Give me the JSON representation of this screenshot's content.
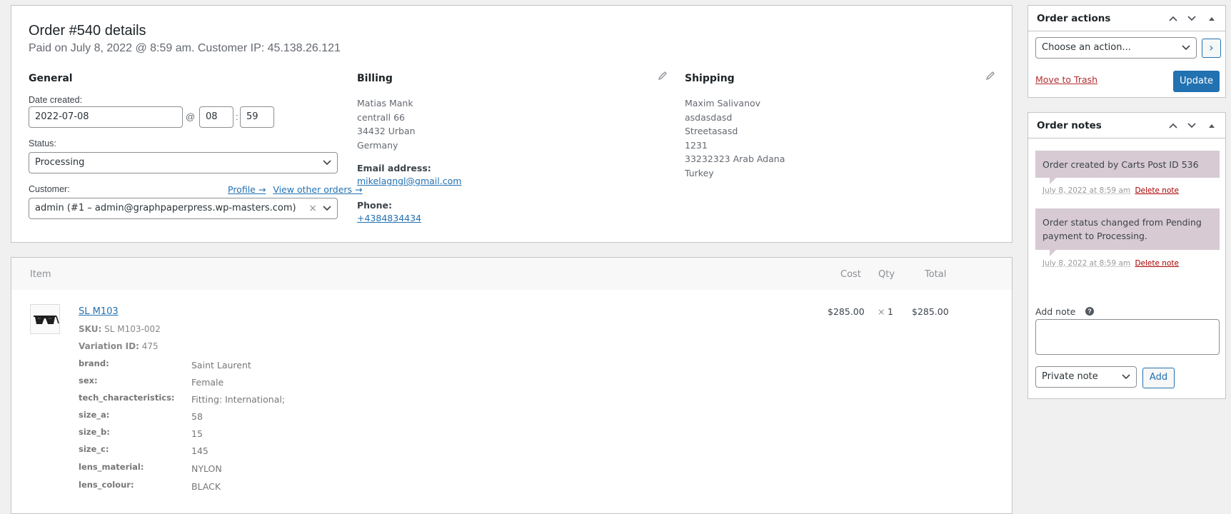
{
  "order": {
    "title": "Order #540 details",
    "subtitle": "Paid on July 8, 2022 @ 8:59 am. Customer IP: 45.138.26.121"
  },
  "general": {
    "heading": "General",
    "date_label": "Date created:",
    "date_value": "2022-07-08",
    "at": "@",
    "hour": "08",
    "colon": ":",
    "minute": "59",
    "status_label": "Status:",
    "status_value": "Processing",
    "customer_label": "Customer:",
    "profile_link": "Profile →",
    "other_orders_link": "View other orders →",
    "customer_value": "admin (#1 – admin@graphpaperpress.wp-masters.com)",
    "clear": "×"
  },
  "billing": {
    "heading": "Billing",
    "lines": [
      "Matias Mank",
      "centrall 66",
      "34432 Urban",
      "Germany"
    ],
    "email_label": "Email address:",
    "email": "mikelagngl@gmail.com",
    "phone_label": "Phone:",
    "phone": "+4384834434"
  },
  "shipping": {
    "heading": "Shipping",
    "lines": [
      "Maxim Salivanov",
      "asdasdasd",
      "Streetasasd",
      "1231",
      "33232323 Arab Adana",
      "Turkey"
    ]
  },
  "items": {
    "headers": {
      "item": "Item",
      "cost": "Cost",
      "qty": "Qty",
      "total": "Total"
    },
    "row": {
      "name": "SL M103",
      "sku_label": "SKU:",
      "sku": "SL M103-002",
      "variation_label": "Variation ID:",
      "variation": "475",
      "cost": "$285.00",
      "times": "×",
      "qty": "1",
      "total": "$285.00",
      "meta": [
        {
          "key": "brand:",
          "value": "Saint Laurent"
        },
        {
          "key": "sex:",
          "value": "Female"
        },
        {
          "key": "tech_characteristics:",
          "value": "Fitting: International;"
        },
        {
          "key": "size_a:",
          "value": "58"
        },
        {
          "key": "size_b:",
          "value": "15"
        },
        {
          "key": "size_c:",
          "value": "145"
        },
        {
          "key": "lens_material:",
          "value": "NYLON"
        },
        {
          "key": "lens_colour:",
          "value": "BLACK"
        }
      ]
    }
  },
  "order_actions": {
    "title": "Order actions",
    "select_value": "Choose an action...",
    "go": "›",
    "trash": "Move to Trash",
    "update": "Update"
  },
  "order_notes": {
    "title": "Order notes",
    "notes": [
      {
        "text": "Order created by Carts Post ID 536",
        "date": "July 8, 2022 at 8:59 am",
        "delete": "Delete note"
      },
      {
        "text": "Order status changed from Pending payment to Processing.",
        "date": "July 8, 2022 at 8:59 am",
        "delete": "Delete note"
      }
    ],
    "add_label": "Add note",
    "help": "?",
    "note_type": "Private note",
    "add_button": "Add"
  },
  "colors": {
    "accent": "#2271b1",
    "note_bg": "#d7cad2",
    "danger": "#b32d2e"
  }
}
